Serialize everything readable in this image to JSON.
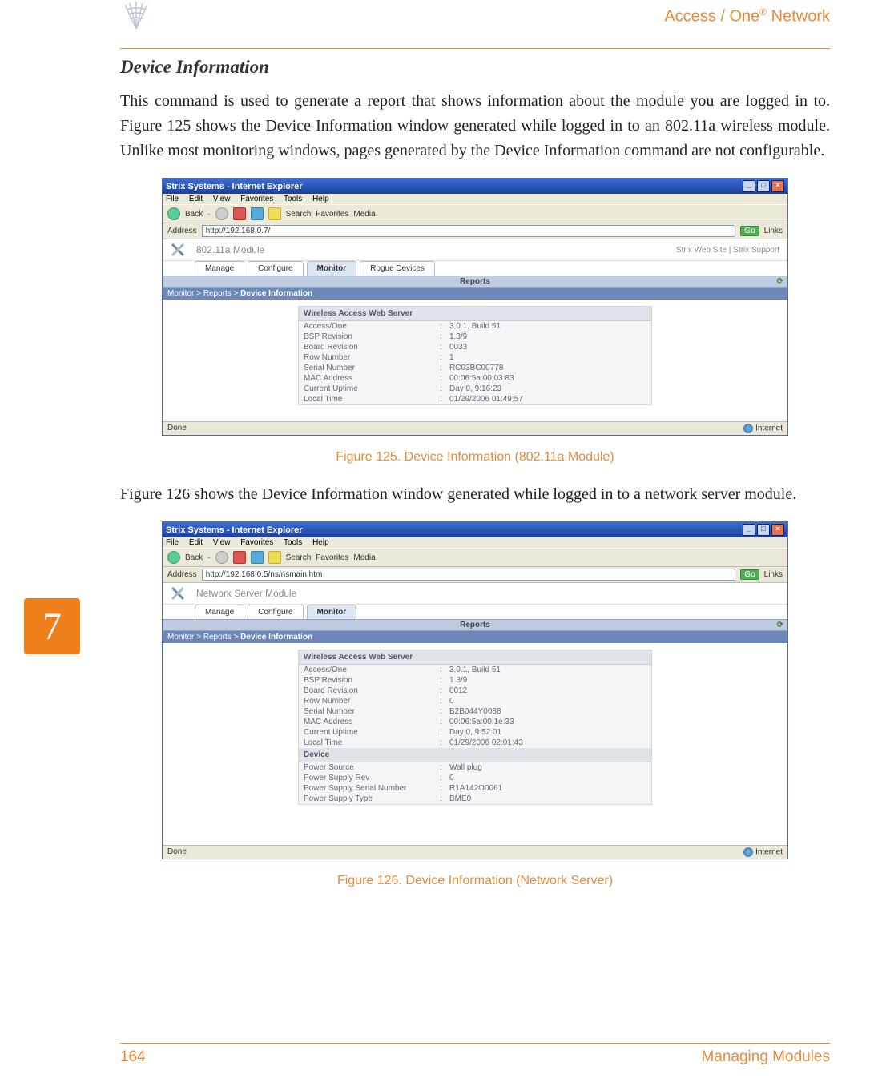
{
  "header": {
    "product_title_1": "Access / One",
    "product_title_2": " Network",
    "reg": "®"
  },
  "section_title": "Device Information",
  "para1": "This command is used to generate a report that shows information about the module you are logged in to. Figure 125 shows the Device Information window generated while logged in to an 802.11a wireless module. Unlike most monitoring windows, pages generated by the Device Information command are not configurable.",
  "para2": "Figure 126 shows the Device Information window generated while logged in to a network server module.",
  "caption1": "Figure 125. Device Information (802.11a Module)",
  "caption2": "Figure 126. Device Information (Network Server)",
  "chapter": "7",
  "page_number": "164",
  "footer_text": "Managing Modules",
  "ie": {
    "title": "Strix Systems - Internet Explorer",
    "menu": {
      "file": "File",
      "edit": "Edit",
      "view": "View",
      "fav": "Favorites",
      "tools": "Tools",
      "help": "Help"
    },
    "toolbar": {
      "back": "Back",
      "search": "Search",
      "favorites": "Favorites",
      "media": "Media"
    },
    "addr_label": "Address",
    "go": "Go",
    "links": "Links",
    "done": "Done",
    "internet": "Internet",
    "reports": "Reports",
    "breadcrumb_prefix": "Monitor > Reports > ",
    "breadcrumb_active": "Device Information",
    "panel_hdr": "Wireless Access Web Server",
    "device_hdr": "Device",
    "tabs": {
      "manage": "Manage",
      "configure": "Configure",
      "monitor": "Monitor",
      "rogue": "Rogue Devices"
    },
    "links_right": "Strix Web Site  |  Strix Support"
  },
  "fig125": {
    "url": "http://192.168.0.7/",
    "module": "802.11a Module",
    "rows": {
      "k1": "Access/One",
      "v1": "3.0.1, Build 51",
      "k2": "BSP Revision",
      "v2": "1.3/9",
      "k3": "Board Revision",
      "v3": "0033",
      "k4": "Row Number",
      "v4": "1",
      "k5": "Serial Number",
      "v5": "RC03BC00778",
      "k6": "MAC Address",
      "v6": "00:06:5a:00:03:83",
      "k7": "Current Uptime",
      "v7": "Day 0, 9:16:23",
      "k8": "Local Time",
      "v8": "01/29/2006 01:49:57"
    }
  },
  "fig126": {
    "url": "http://192.168.0.5/ns/nsmain.htm",
    "module": "Network Server Module",
    "rows": {
      "k1": "Access/One",
      "v1": "3.0.1, Build 51",
      "k2": "BSP Revision",
      "v2": "1.3/9",
      "k3": "Board Revision",
      "v3": "0012",
      "k4": "Row Number",
      "v4": "0",
      "k5": "Serial Number",
      "v5": "B2B044Y0088",
      "k6": "MAC Address",
      "v6": "00:06:5a:00:1e:33",
      "k7": "Current Uptime",
      "v7": "Day 0, 9:52:01",
      "k8": "Local Time",
      "v8": "01/29/2006 02:01:43",
      "d1": "Power Source",
      "dv1": "Wall plug",
      "d2": "Power Supply Rev",
      "dv2": "0",
      "d3": "Power Supply Serial Number",
      "dv3": "R1A142O0061",
      "d4": "Power Supply Type",
      "dv4": "BME0"
    }
  }
}
